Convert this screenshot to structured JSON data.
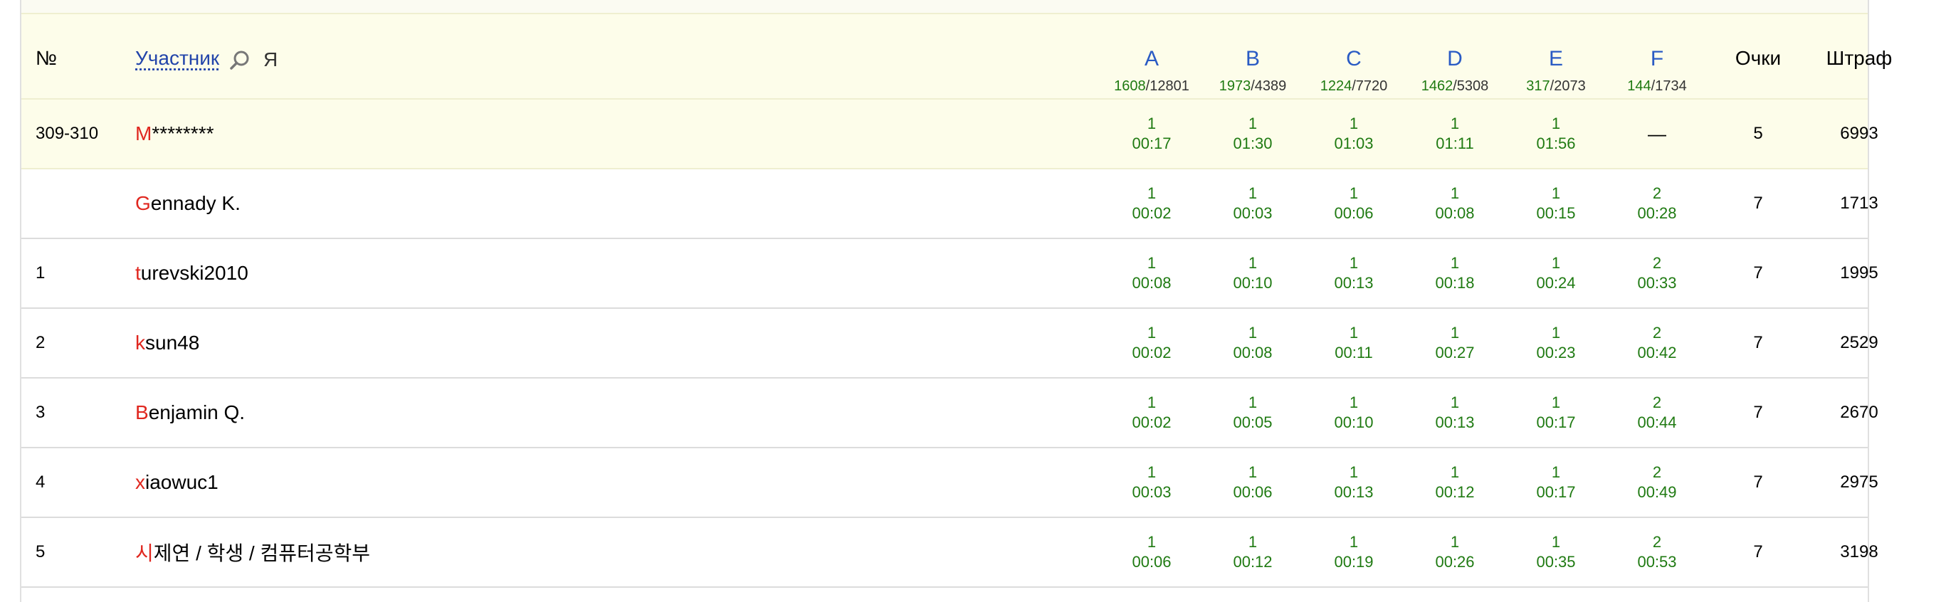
{
  "header": {
    "rank": "№",
    "participant": "Участник",
    "me": "Я",
    "points": "Очки",
    "penalty": "Штраф",
    "problems": [
      {
        "letter": "A",
        "accepted": "1608",
        "tried": "12801"
      },
      {
        "letter": "B",
        "accepted": "1973",
        "tried": "4389"
      },
      {
        "letter": "C",
        "accepted": "1224",
        "tried": "7720"
      },
      {
        "letter": "D",
        "accepted": "1462",
        "tried": "5308"
      },
      {
        "letter": "E",
        "accepted": "317",
        "tried": "2073"
      },
      {
        "letter": "F",
        "accepted": "144",
        "tried": "1734"
      }
    ]
  },
  "rows": [
    {
      "rank": "309-310",
      "first": "M",
      "rest": "********",
      "points": "5",
      "penalty": "6993",
      "cells": [
        {
          "a": "1",
          "t": "00:17"
        },
        {
          "a": "1",
          "t": "01:30"
        },
        {
          "a": "1",
          "t": "01:03"
        },
        {
          "a": "1",
          "t": "01:11"
        },
        {
          "a": "1",
          "t": "01:56"
        },
        {
          "dash": "—"
        }
      ]
    },
    {
      "rank": "",
      "first": "G",
      "rest": "ennady K.",
      "points": "7",
      "penalty": "1713",
      "cells": [
        {
          "a": "1",
          "t": "00:02"
        },
        {
          "a": "1",
          "t": "00:03"
        },
        {
          "a": "1",
          "t": "00:06"
        },
        {
          "a": "1",
          "t": "00:08"
        },
        {
          "a": "1",
          "t": "00:15"
        },
        {
          "a": "2",
          "t": "00:28"
        }
      ]
    },
    {
      "rank": "1",
      "first": "t",
      "rest": "urevski2010",
      "points": "7",
      "penalty": "1995",
      "cells": [
        {
          "a": "1",
          "t": "00:08"
        },
        {
          "a": "1",
          "t": "00:10"
        },
        {
          "a": "1",
          "t": "00:13"
        },
        {
          "a": "1",
          "t": "00:18"
        },
        {
          "a": "1",
          "t": "00:24"
        },
        {
          "a": "2",
          "t": "00:33"
        }
      ]
    },
    {
      "rank": "2",
      "first": "k",
      "rest": "sun48",
      "points": "7",
      "penalty": "2529",
      "cells": [
        {
          "a": "1",
          "t": "00:02"
        },
        {
          "a": "1",
          "t": "00:08"
        },
        {
          "a": "1",
          "t": "00:11"
        },
        {
          "a": "1",
          "t": "00:27"
        },
        {
          "a": "1",
          "t": "00:23"
        },
        {
          "a": "2",
          "t": "00:42"
        }
      ]
    },
    {
      "rank": "3",
      "first": "B",
      "rest": "enjamin Q.",
      "points": "7",
      "penalty": "2670",
      "cells": [
        {
          "a": "1",
          "t": "00:02"
        },
        {
          "a": "1",
          "t": "00:05"
        },
        {
          "a": "1",
          "t": "00:10"
        },
        {
          "a": "1",
          "t": "00:13"
        },
        {
          "a": "1",
          "t": "00:17"
        },
        {
          "a": "2",
          "t": "00:44"
        }
      ]
    },
    {
      "rank": "4",
      "first": "x",
      "rest": "iaowuc1",
      "points": "7",
      "penalty": "2975",
      "cells": [
        {
          "a": "1",
          "t": "00:03"
        },
        {
          "a": "1",
          "t": "00:06"
        },
        {
          "a": "1",
          "t": "00:13"
        },
        {
          "a": "1",
          "t": "00:12"
        },
        {
          "a": "1",
          "t": "00:17"
        },
        {
          "a": "2",
          "t": "00:49"
        }
      ]
    },
    {
      "rank": "5",
      "first": "시",
      "rest": "제연 / 학생 / 컴퓨터공학부",
      "points": "7",
      "penalty": "3198",
      "cells": [
        {
          "a": "1",
          "t": "00:06"
        },
        {
          "a": "1",
          "t": "00:12"
        },
        {
          "a": "1",
          "t": "00:19"
        },
        {
          "a": "1",
          "t": "00:26"
        },
        {
          "a": "1",
          "t": "00:35"
        },
        {
          "a": "2",
          "t": "00:53"
        }
      ]
    }
  ]
}
